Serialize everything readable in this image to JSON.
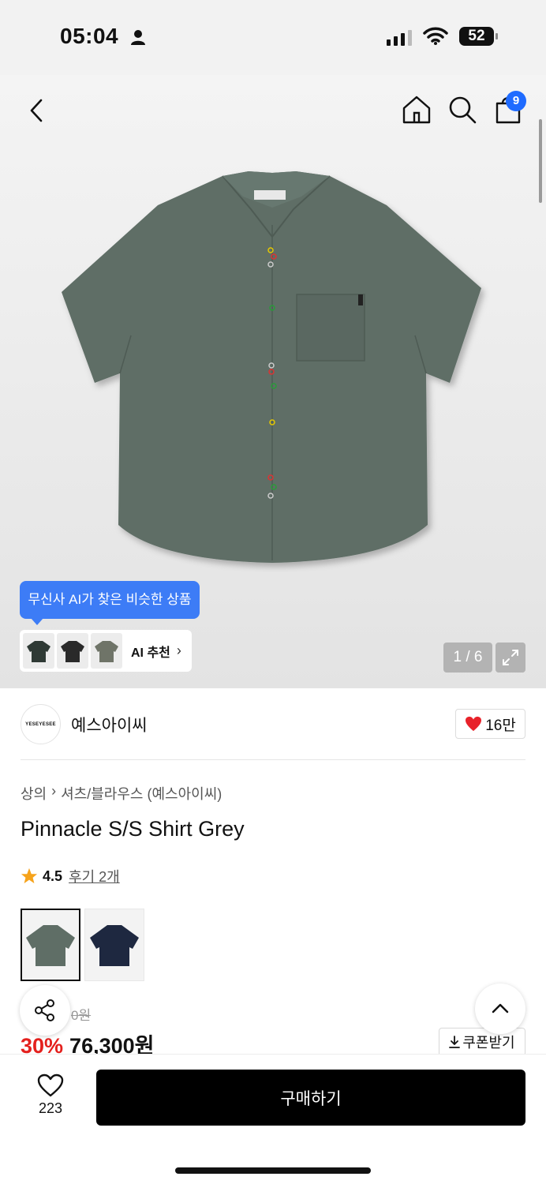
{
  "status_bar": {
    "time": "05:04",
    "battery": "52"
  },
  "header": {
    "cart_count": "9"
  },
  "gallery": {
    "ai_tooltip": "무신사 AI가 찾은 비슷한 상품",
    "ai_label": "AI 추천",
    "counter": "1 / 6",
    "shirt_color": "#5f6e66"
  },
  "brand": {
    "logo_text": "YESEYESEE",
    "name": "예스아이씨",
    "likes": "16만"
  },
  "breadcrumb": [
    "상의",
    "셔츠/블라우스 (예스아이씨)"
  ],
  "product": {
    "title": "Pinnacle S/S Shirt Grey",
    "rating": "4.5",
    "reviews": "후기 2개",
    "original_price": "0원",
    "discount": "30%",
    "price": "76,300원",
    "coupon_label": "쿠폰받기"
  },
  "bottom": {
    "wish_count": "223",
    "buy_label": "구매하기"
  },
  "colors": {
    "accent_blue": "#3d7cf6",
    "discount_red": "#e4201d",
    "heart_red": "#e8222a"
  }
}
